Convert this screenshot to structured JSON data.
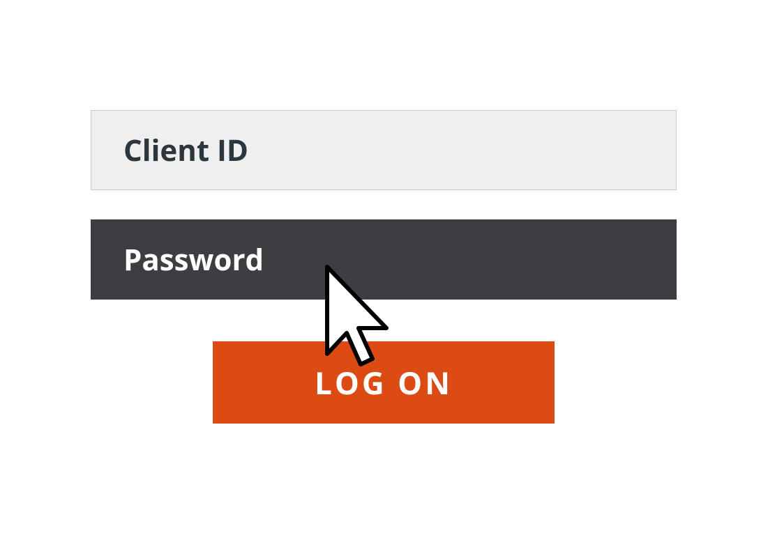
{
  "form": {
    "client_id": {
      "placeholder": "Client ID",
      "value": ""
    },
    "password": {
      "placeholder": "Password",
      "value": ""
    },
    "submit_label": "LOG ON"
  },
  "colors": {
    "accent": "#dd4b14",
    "dark_field": "#3e3d42",
    "light_field": "#efefef"
  }
}
